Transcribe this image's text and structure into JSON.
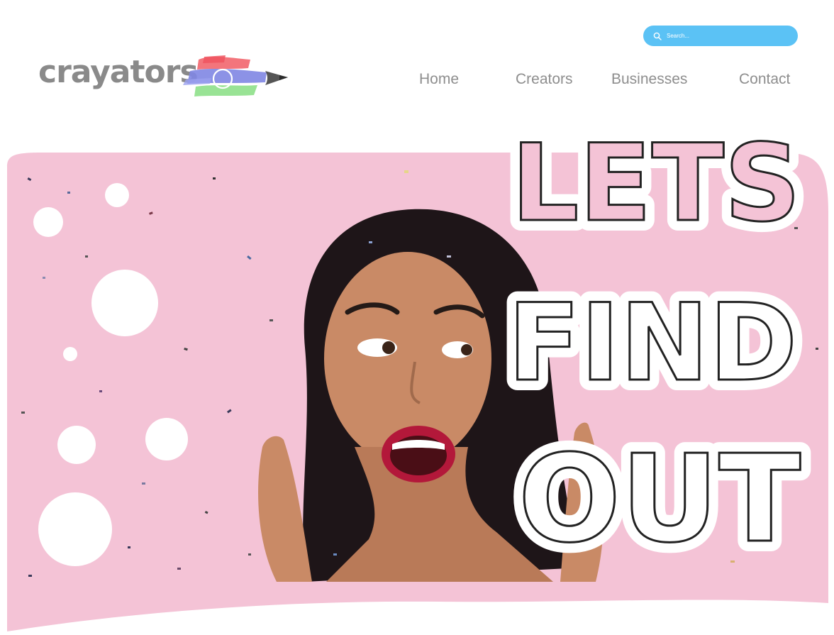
{
  "search": {
    "placeholder": "Search..."
  },
  "logo": {
    "text": "crayators"
  },
  "nav": {
    "items": [
      {
        "label": "Home"
      },
      {
        "label": "Creators"
      },
      {
        "label": "Businesses"
      },
      {
        "label": "Contact"
      }
    ]
  },
  "hero": {
    "headline_lines": [
      "LETS",
      "FIND",
      "OUT"
    ]
  },
  "colors": {
    "search_bar": "#5bc2f5",
    "hero_background": "#f4c3d6",
    "nav_text": "#8e8e8e",
    "logo_text": "#8a8a8a",
    "headline_fill": "#ffffff",
    "headline_outline": "#222222"
  }
}
